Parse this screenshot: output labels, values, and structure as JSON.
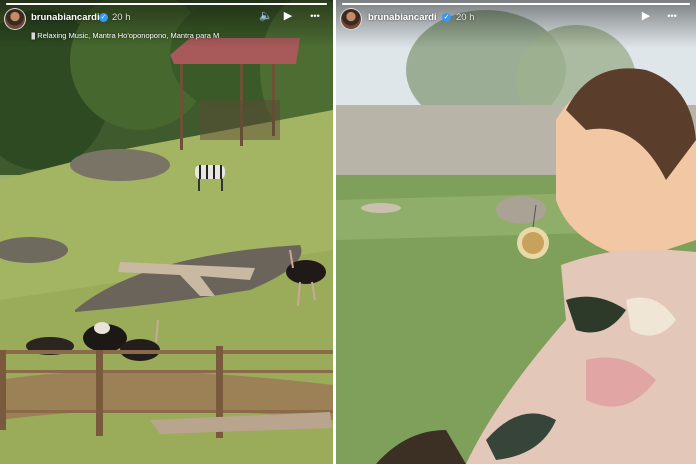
{
  "left_story": {
    "username": "brunabiancardi",
    "time": "20 h",
    "music": "Relaxing Music, Mantra Ho'oponopono, Mantra para M",
    "progress": 1.0,
    "icons": {
      "verified": "verified-badge-icon",
      "sound": "speaker-icon",
      "play": "play-icon",
      "more": "more-dots-icon",
      "music": "music-bars-icon"
    }
  },
  "right_story": {
    "username": "brunabiancardi",
    "time": "20 h",
    "progress": 1.0,
    "icons": {
      "verified": "verified-badge-icon",
      "play": "play-icon",
      "more": "more-dots-icon"
    }
  },
  "glyphs": {
    "verified": "✓",
    "play": "▶",
    "more": "•••",
    "sound": "🔈",
    "music": "|||"
  },
  "colors": {
    "verified_blue": "#3897f0",
    "header_text": "#ffffff"
  }
}
